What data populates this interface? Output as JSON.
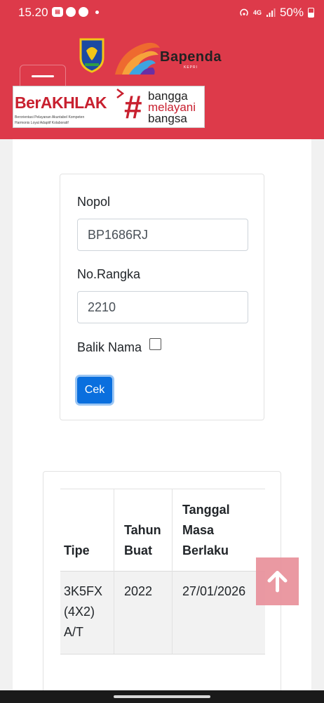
{
  "status_bar": {
    "time": "15.20",
    "left_icons": [
      "notification-badge-icon",
      "chat-icon",
      "app-icon"
    ],
    "right_icons": [
      "hotspot-icon",
      "4g-signal-icon",
      "signal-bars-icon",
      "battery-icon"
    ],
    "network_label": "4G",
    "battery": "50%"
  },
  "header": {
    "brand": "Bapenda",
    "brand_sub": "KEPRI",
    "background_color": "#dd3a4a",
    "banner": {
      "title": "BerAKHLAK",
      "subtitle_line1": "Berorientasi Pelayanan Akuntabel Kompeten",
      "subtitle_line2": "Harmonis Loyal Adaptif Kolaboratif",
      "hashtag": "#",
      "words": [
        "bangga",
        "melayani",
        "bangsa"
      ]
    }
  },
  "form": {
    "nopol_label": "Nopol",
    "nopol_value": "BP1686RJ",
    "rangka_label": "No.Rangka",
    "rangka_value": "2210",
    "balik_nama_label": "Balik Nama",
    "submit_label": "Cek",
    "button_color": "#0a6fde"
  },
  "result_table": {
    "headers": [
      "Tipe",
      "Tahun Buat",
      "Tanggal Masa Berlaku"
    ],
    "header_lines": [
      [
        "Tipe"
      ],
      [
        "Tahun",
        "Buat"
      ],
      [
        "Tanggal",
        "Masa",
        "Berlaku"
      ]
    ],
    "rows": [
      {
        "tipe": "3K5FX (4X2) A/T",
        "tipe_lines": [
          "3K5FX",
          "(4X2)",
          "A/T"
        ],
        "tahun_buat": "2022",
        "masa_berlaku": "27/01/2026"
      }
    ]
  },
  "scroll_top": {
    "icon": "arrow-up-icon",
    "color": "#e9949e"
  }
}
